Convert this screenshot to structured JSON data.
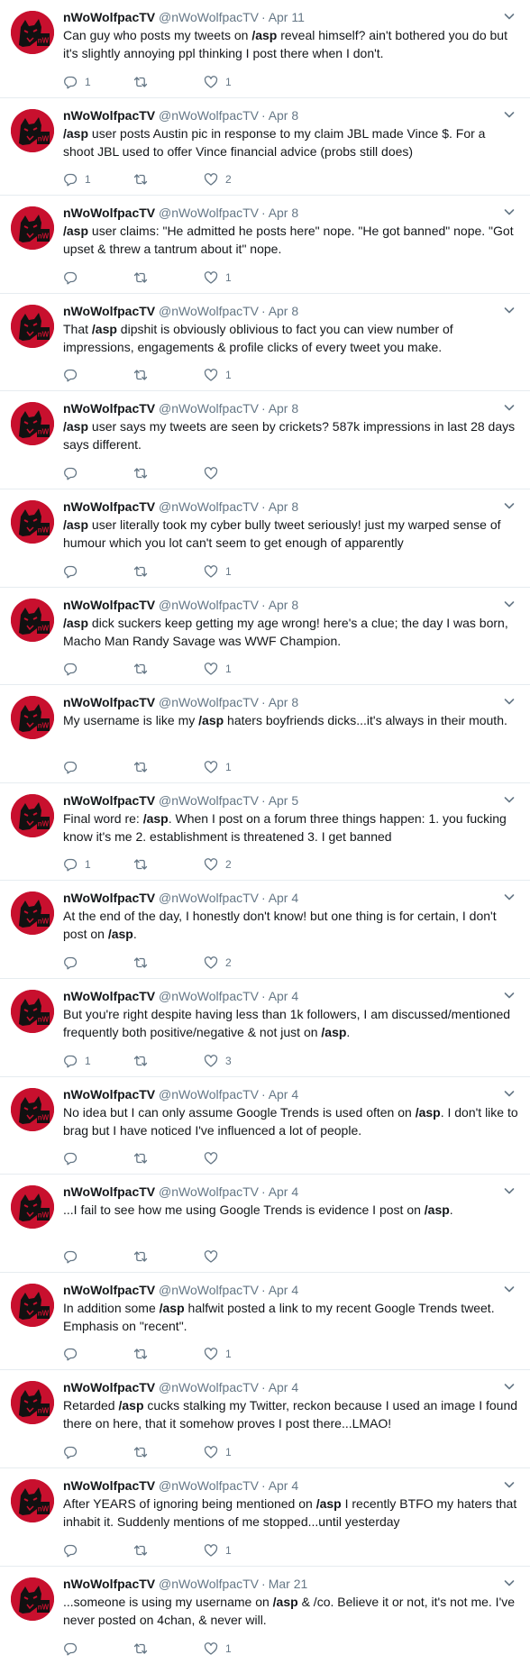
{
  "author": {
    "name": "nWoWolfpacTV",
    "handle": "@nWoWolfpacTV",
    "avatar_color": "#c8102e"
  },
  "icons": {
    "reply": "reply-icon",
    "retweet": "retweet-icon",
    "like": "heart-icon",
    "menu": "chevron-down-icon"
  },
  "tweets": [
    {
      "time": "Apr 11",
      "text": [
        {
          "t": "Can guy who posts my tweets on "
        },
        {
          "t": "/asp",
          "b": true
        },
        {
          "t": " reveal himself? ain't bothered you do but it's slightly annoying ppl thinking I post there when I don't."
        }
      ],
      "replies": "1",
      "retweets": "",
      "likes": "1"
    },
    {
      "time": "Apr 8",
      "text": [
        {
          "t": "/asp",
          "b": true
        },
        {
          "t": " user posts Austin pic in response to my claim JBL made Vince $. For a shoot JBL used to offer Vince financial advice (probs still does)"
        }
      ],
      "replies": "1",
      "retweets": "",
      "likes": "2"
    },
    {
      "time": "Apr 8",
      "text": [
        {
          "t": "/asp",
          "b": true
        },
        {
          "t": " user claims: \"He admitted he posts here\" nope. \"He got banned\" nope. \"Got upset & threw a tantrum about it\" nope."
        }
      ],
      "replies": "",
      "retweets": "",
      "likes": "1"
    },
    {
      "time": "Apr 8",
      "text": [
        {
          "t": "That "
        },
        {
          "t": "/asp",
          "b": true
        },
        {
          "t": " dipshit is obviously oblivious to fact you can view number of impressions, engagements & profile clicks of every tweet you make."
        }
      ],
      "replies": "",
      "retweets": "",
      "likes": "1"
    },
    {
      "time": "Apr 8",
      "text": [
        {
          "t": "/asp",
          "b": true
        },
        {
          "t": " user says my tweets are seen by crickets? 587k impressions in last 28 days says different."
        }
      ],
      "replies": "",
      "retweets": "",
      "likes": ""
    },
    {
      "time": "Apr 8",
      "text": [
        {
          "t": "/asp",
          "b": true
        },
        {
          "t": " user literally took my cyber bully tweet seriously! just my warped sense of humour which you lot can't seem to get enough of apparently"
        }
      ],
      "replies": "",
      "retweets": "",
      "likes": "1"
    },
    {
      "time": "Apr 8",
      "text": [
        {
          "t": "/asp",
          "b": true
        },
        {
          "t": " dick suckers keep getting my age wrong! here's a clue; the day I was born, Macho Man Randy Savage was WWF Champion."
        }
      ],
      "replies": "",
      "retweets": "",
      "likes": "1"
    },
    {
      "time": "Apr 8",
      "text": [
        {
          "t": "My username is like my "
        },
        {
          "t": "/asp",
          "b": true
        },
        {
          "t": " haters boyfriends dicks...it's always in their mouth."
        }
      ],
      "replies": "",
      "retweets": "",
      "likes": "1"
    },
    {
      "time": "Apr 5",
      "text": [
        {
          "t": "Final word re: "
        },
        {
          "t": "/asp",
          "b": true
        },
        {
          "t": ". When I post on a forum three things happen: 1. you fucking know it's me 2. establishment is threatened 3. I get banned"
        }
      ],
      "replies": "1",
      "retweets": "",
      "likes": "2"
    },
    {
      "time": "Apr 4",
      "text": [
        {
          "t": "At the end of the day, I honestly don't know! but one thing is for certain, I don't post on "
        },
        {
          "t": "/asp",
          "b": true
        },
        {
          "t": "."
        }
      ],
      "replies": "",
      "retweets": "",
      "likes": "2"
    },
    {
      "time": "Apr 4",
      "text": [
        {
          "t": "But you're right despite having less than 1k followers, I am discussed/mentioned frequently both positive/negative & not just on "
        },
        {
          "t": "/asp",
          "b": true
        },
        {
          "t": "."
        }
      ],
      "replies": "1",
      "retweets": "",
      "likes": "3"
    },
    {
      "time": "Apr 4",
      "text": [
        {
          "t": "No idea but I can only assume Google Trends is used often on "
        },
        {
          "t": "/asp",
          "b": true
        },
        {
          "t": ". I don't like to brag but I have noticed I've influenced a lot of people."
        }
      ],
      "replies": "",
      "retweets": "",
      "likes": ""
    },
    {
      "time": "Apr 4",
      "text": [
        {
          "t": "...I fail to see how me using Google Trends is evidence I post on "
        },
        {
          "t": "/asp",
          "b": true
        },
        {
          "t": "."
        }
      ],
      "replies": "",
      "retweets": "",
      "likes": ""
    },
    {
      "time": "Apr 4",
      "text": [
        {
          "t": "In addition some "
        },
        {
          "t": "/asp",
          "b": true
        },
        {
          "t": " halfwit posted a link to my recent Google Trends tweet. Emphasis on \"recent\"."
        }
      ],
      "replies": "",
      "retweets": "",
      "likes": "1"
    },
    {
      "time": "Apr 4",
      "text": [
        {
          "t": "Retarded "
        },
        {
          "t": "/asp",
          "b": true
        },
        {
          "t": " cucks stalking my Twitter, reckon because I used an image I found there on here, that it somehow proves I post there...LMAO!"
        }
      ],
      "replies": "",
      "retweets": "",
      "likes": "1"
    },
    {
      "time": "Apr 4",
      "text": [
        {
          "t": "After YEARS of ignoring being mentioned on "
        },
        {
          "t": "/asp",
          "b": true
        },
        {
          "t": " I recently BTFO my haters that inhabit it. Suddenly mentions of me stopped...until yesterday"
        }
      ],
      "replies": "",
      "retweets": "",
      "likes": "1"
    },
    {
      "time": "Mar 21",
      "text": [
        {
          "t": "...someone is using my username on "
        },
        {
          "t": "/asp",
          "b": true
        },
        {
          "t": " & /co. Believe it or not, it's not me. I've never posted on 4chan, & never will."
        }
      ],
      "replies": "",
      "retweets": "",
      "likes": "1"
    }
  ]
}
